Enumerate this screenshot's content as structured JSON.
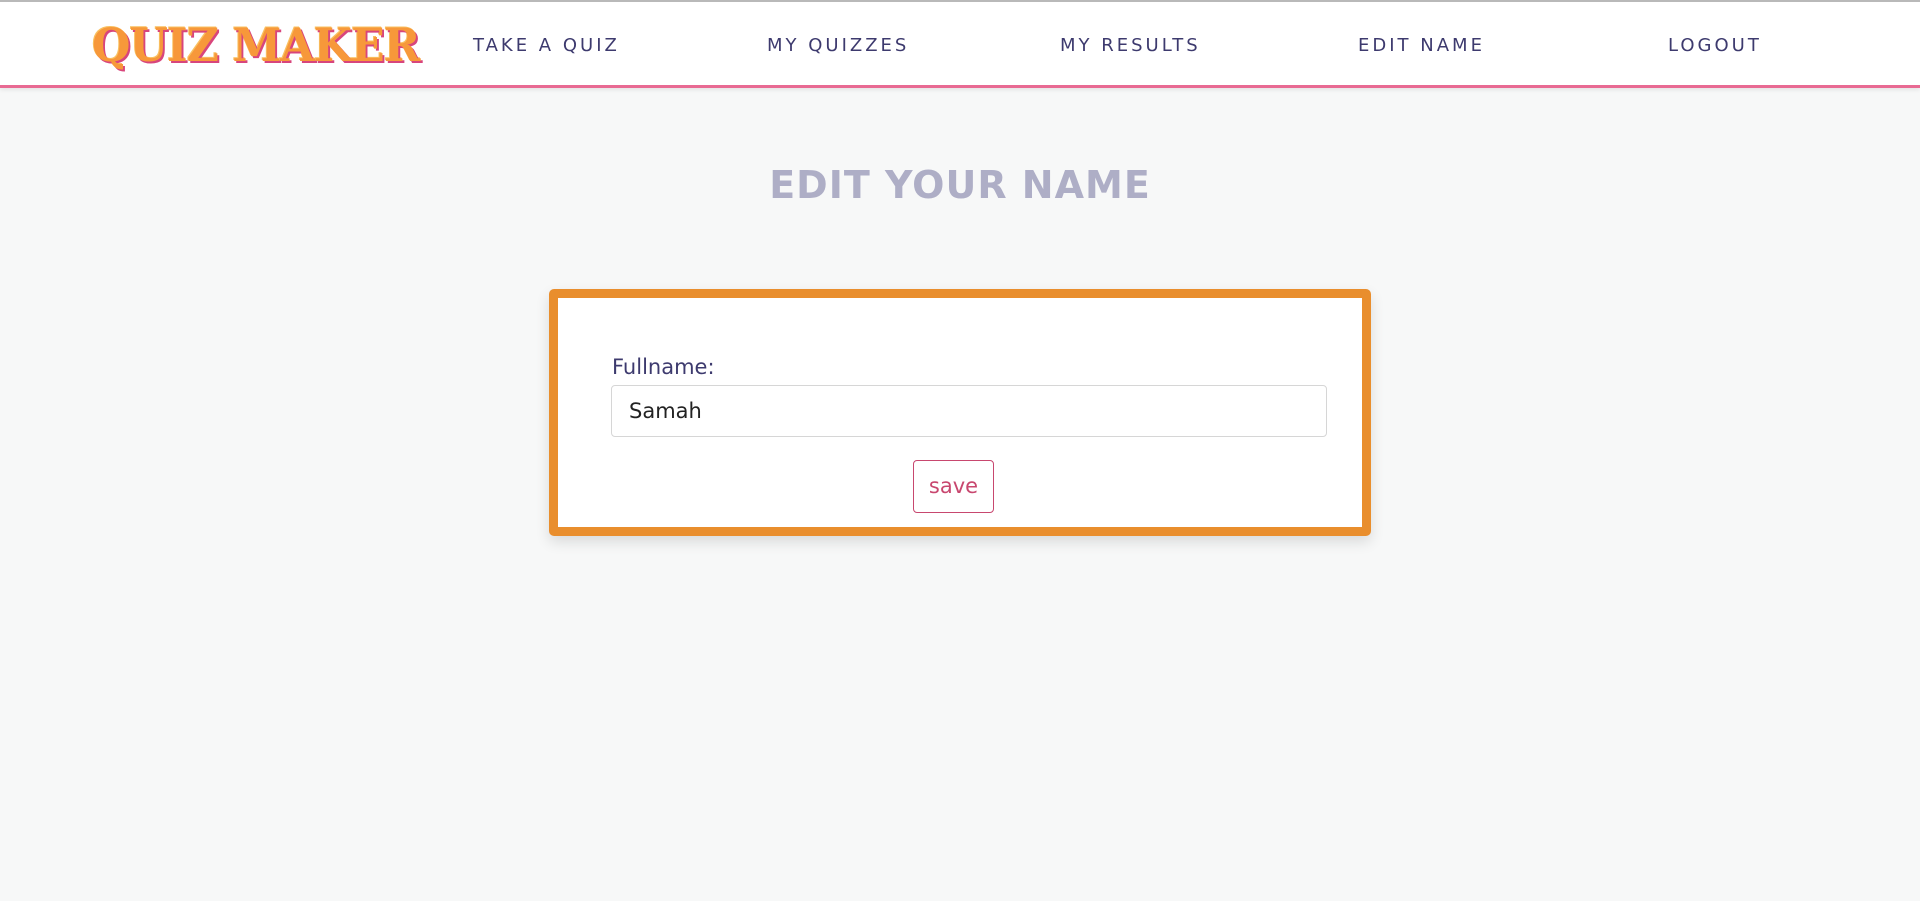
{
  "header": {
    "logo_text": "QUIZ MAKER",
    "nav": {
      "take_quiz": "TAKE A QUIZ",
      "my_quizzes": "MY QUIZZES",
      "my_results": "MY RESULTS",
      "edit_name": "EDIT NAME",
      "logout": "LOGOUT"
    }
  },
  "main": {
    "title": "EDIT YOUR NAME",
    "form": {
      "fullname_label": "Fullname:",
      "fullname_value": "Samah",
      "save_label": "save"
    }
  },
  "colors": {
    "logo": "#f7983a",
    "logo_shadow": "#d8457c",
    "nav_text": "#3d3a6e",
    "header_border": "#e86a93",
    "title": "#aeaec6",
    "card_border": "#e98e2d",
    "save_button": "#c8476f",
    "page_background": "#f7f8f8"
  }
}
